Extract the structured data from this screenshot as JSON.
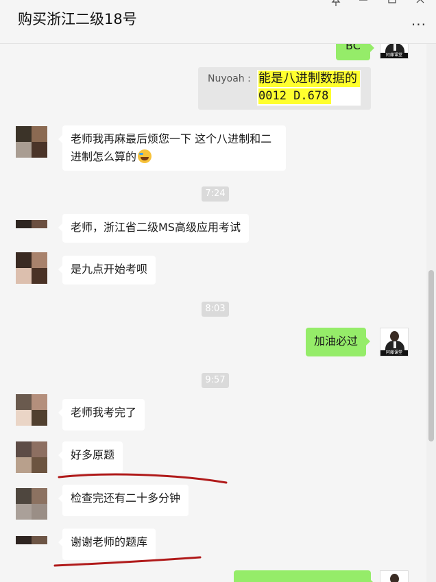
{
  "header": {
    "title": "购买浙江二级18号",
    "pin_icon": "pin-icon",
    "minimize_icon": "minimize-icon",
    "maximize_icon": "maximize-icon",
    "close_icon": "close-icon",
    "more_icon": "more-icon"
  },
  "colors": {
    "background": "#f5f5f5",
    "bubble_self": "#95ec69",
    "bubble_other": "#ffffff",
    "highlight": "#ffff2e",
    "annotation_underline": "#b01a1a"
  },
  "self_avatar": {
    "label": "阿藤课堂"
  },
  "messages": {
    "top_self": "BC",
    "quote": {
      "name": "Nuyoah :",
      "line1": "能是八进制数据的",
      "line2": "0012 D.678"
    },
    "m1": "老师我再麻最后烦您一下 这个八进制和二进制怎么算的",
    "m2": "老师，浙江省二级MS高级应用考试",
    "m3": "是九点开始考呗",
    "m4": "加油必过",
    "m5": "老师我考完了",
    "m6": "好多原题",
    "m7": "检查完还有二十多分钟",
    "m8": "谢谢老师的题库"
  },
  "times": {
    "t1": "7:24",
    "t2": "8:03",
    "t3": "9:57"
  }
}
